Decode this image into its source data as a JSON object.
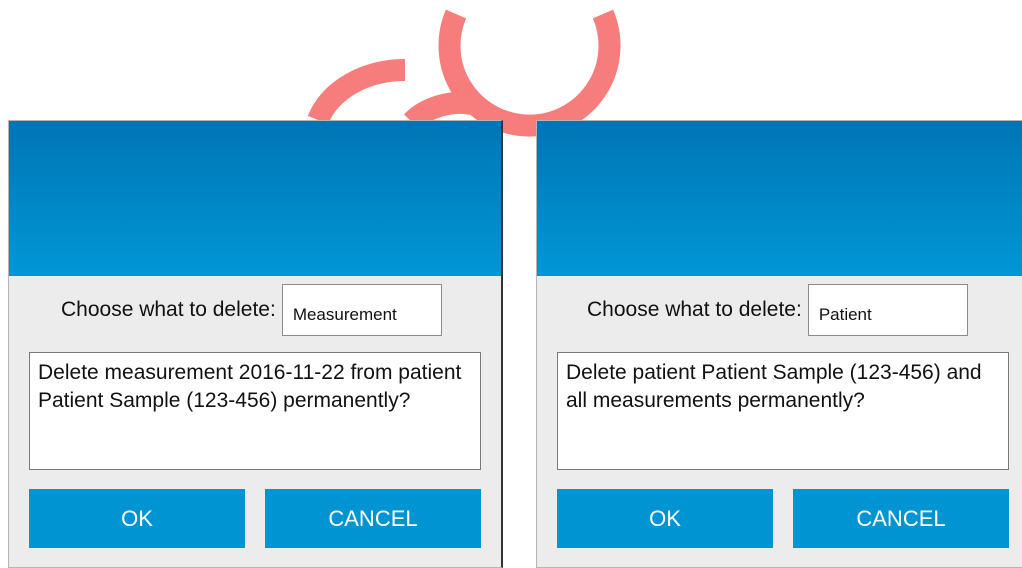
{
  "colors": {
    "header_gradient_top": "#0075b5",
    "header_gradient_bottom": "#0096d6",
    "button_bg": "#0094d3",
    "button_text": "#ffffff",
    "dialog_bg": "#ececec",
    "decoration": "#f77d7d"
  },
  "dialogs": [
    {
      "choose_label": "Choose what to delete:",
      "choose_value": "Measurement",
      "message": "Delete measurement 2016-11-22 from patient Patient Sample (123-456) permanently?",
      "ok_label": "OK",
      "cancel_label": "CANCEL"
    },
    {
      "choose_label": "Choose what to delete:",
      "choose_value": "Patient",
      "message": "Delete patient Patient Sample (123-456) and all measurements permanently?",
      "ok_label": "OK",
      "cancel_label": "CANCEL"
    }
  ]
}
